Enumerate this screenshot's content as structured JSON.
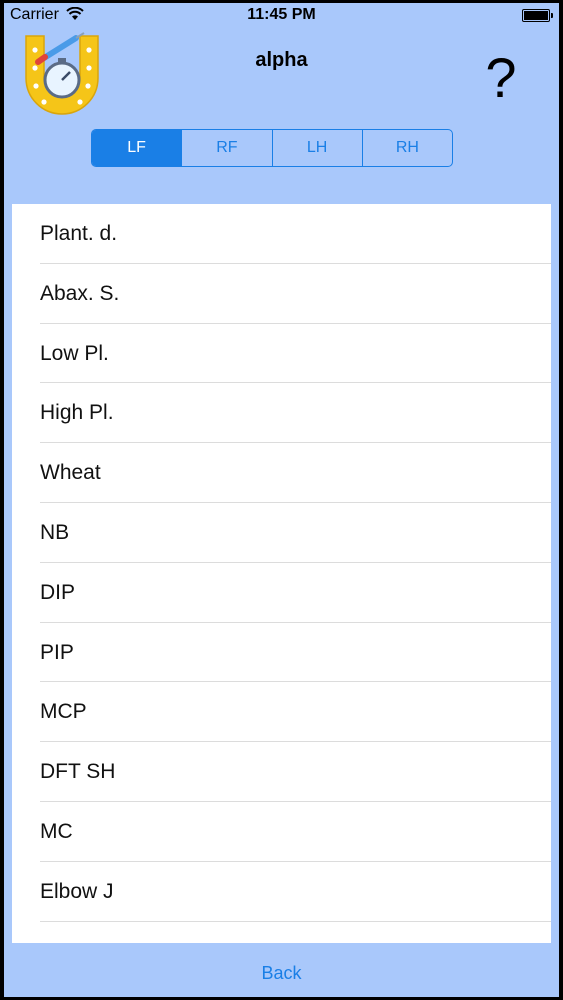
{
  "status_bar": {
    "carrier": "Carrier",
    "time": "11:45 PM"
  },
  "header": {
    "title": "alpha",
    "help_label": "?"
  },
  "segments": [
    {
      "label": "LF",
      "selected": true
    },
    {
      "label": "RF",
      "selected": false
    },
    {
      "label": "LH",
      "selected": false
    },
    {
      "label": "RH",
      "selected": false
    }
  ],
  "list": {
    "items": [
      "Plant. d.",
      "Abax. S.",
      "Low Pl.",
      "High Pl.",
      "Wheat",
      "NB",
      "DIP",
      "PIP",
      "MCP",
      "DFT SH",
      "MC",
      "Elbow J"
    ]
  },
  "footer": {
    "back_label": "Back"
  },
  "colors": {
    "background": "#a9c8fb",
    "accent": "#1a7fe6",
    "logo": "#f5c518"
  },
  "icons": {
    "logo": "horseshoe-logo-icon",
    "wifi": "wifi-icon",
    "battery": "battery-icon"
  }
}
